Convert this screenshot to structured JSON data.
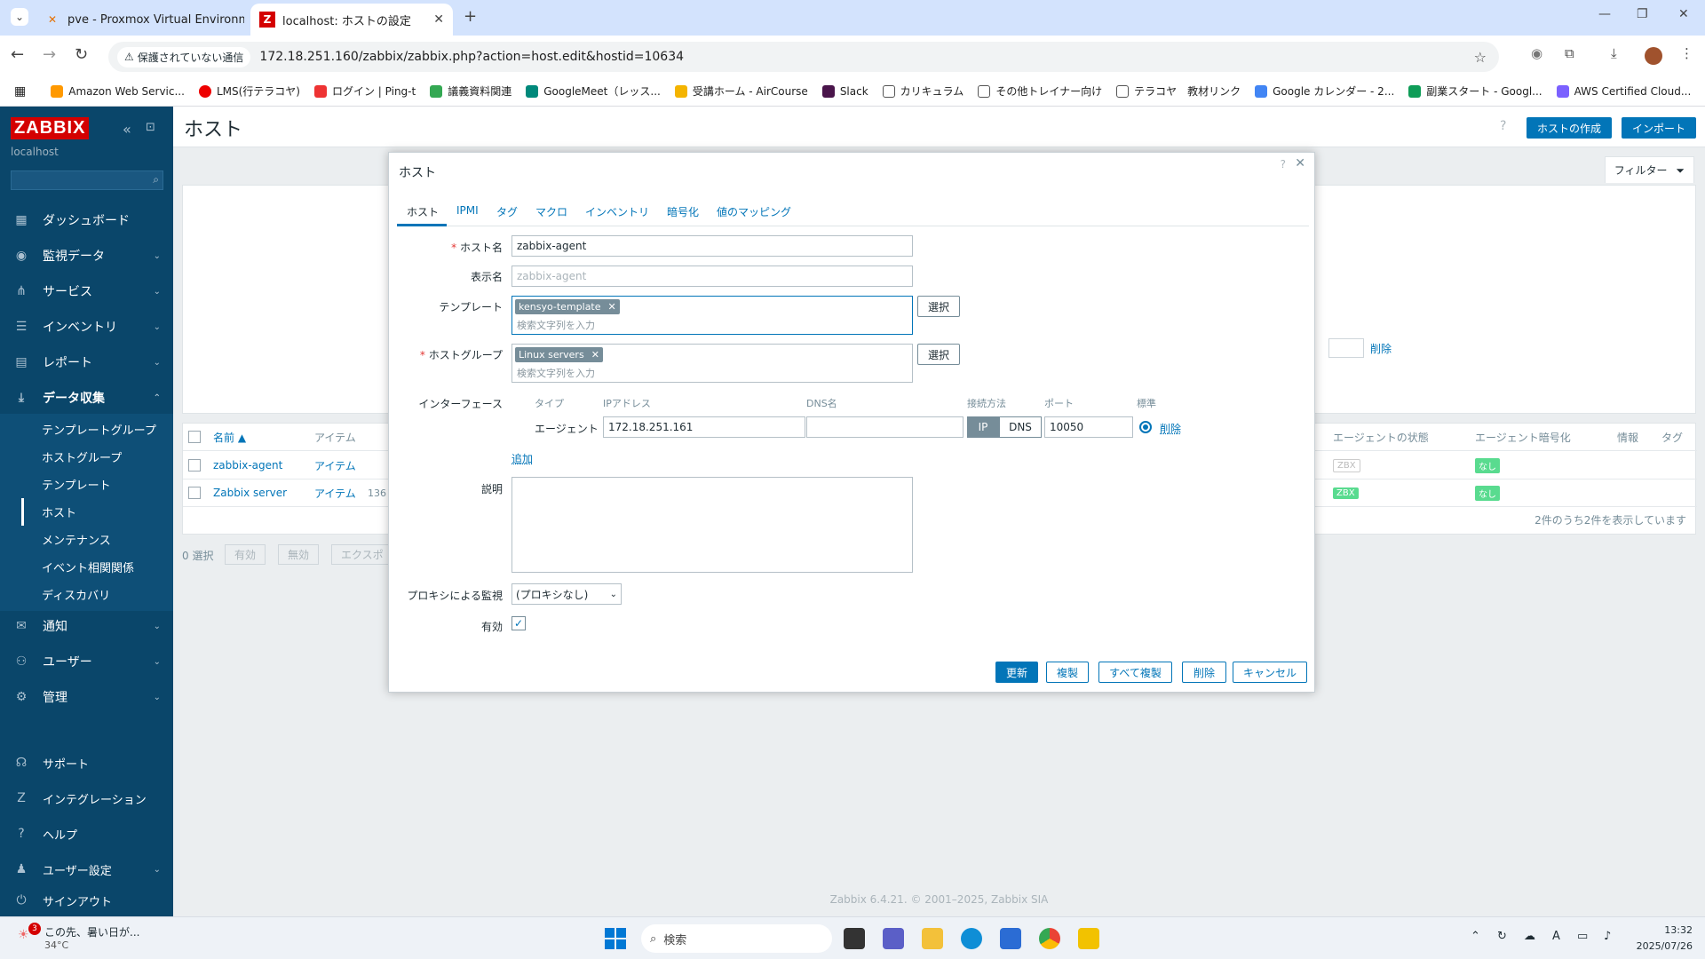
{
  "browser": {
    "tabs": [
      {
        "title": "pve - Proxmox Virtual Environm"
      },
      {
        "title": "localhost: ホストの設定"
      }
    ],
    "security_label": "保護されていない通信",
    "url": "172.18.251.160/zabbix/zabbix.php?action=host.edit&hostid=10634",
    "bookmarks": [
      "Amazon Web Servic...",
      "LMS(行テラコヤ)",
      "ログイン | Ping-t",
      "議義資料関連",
      "GoogleMeet（レッス...",
      "受講ホーム - AirCourse",
      "Slack",
      "カリキュラム",
      "その他トレイナー向け",
      "テラコヤ　教材リンク",
      "Google カレンダー - 2...",
      "副業スタート - Googl...",
      "AWS Certified Cloud..."
    ]
  },
  "sidebar": {
    "logo": "ZABBIX",
    "server": "localhost",
    "items": [
      {
        "label": "ダッシュボード",
        "icon": "dashboard-icon"
      },
      {
        "label": "監視データ",
        "icon": "eye-icon"
      },
      {
        "label": "サービス",
        "icon": "services-icon"
      },
      {
        "label": "インベントリ",
        "icon": "list-icon"
      },
      {
        "label": "レポート",
        "icon": "report-icon"
      },
      {
        "label": "データ収集",
        "icon": "download-icon"
      }
    ],
    "sub_items": [
      "テンプレートグループ",
      "ホストグループ",
      "テンプレート",
      "ホスト",
      "メンテナンス",
      "イベント相関関係",
      "ディスカバリ"
    ],
    "items2": [
      {
        "label": "通知",
        "icon": "mail-icon"
      },
      {
        "label": "ユーザー",
        "icon": "users-icon"
      },
      {
        "label": "管理",
        "icon": "gear-icon"
      }
    ],
    "bottom": [
      {
        "label": "サポート",
        "icon": "headset-icon"
      },
      {
        "label": "インテグレーション",
        "icon": "integration-icon"
      },
      {
        "label": "ヘルプ",
        "icon": "help-icon"
      },
      {
        "label": "ユーザー設定",
        "icon": "user-icon"
      },
      {
        "label": "サインアウト",
        "icon": "power-icon"
      }
    ]
  },
  "page": {
    "title": "ホスト",
    "create_host": "ホストの作成",
    "import": "インポート",
    "filter": "フィルター",
    "filter_delete": "削除",
    "footer": "Zabbix 6.4.21. © 2001–2025, Zabbix SIA"
  },
  "list": {
    "headers": {
      "name": "名前 ▲",
      "items": "アイテム",
      "agent_status": "エージェントの状態",
      "agent_encryption": "エージェント暗号化",
      "info": "情報",
      "tags": "タグ"
    },
    "rows": [
      {
        "name": "zabbix-agent",
        "items": "アイテム",
        "items_count": "",
        "zbx": "ZBX",
        "enc": "なし"
      },
      {
        "name": "Zabbix server",
        "items": "アイテム",
        "items_count": "136",
        "zbx": "ZBX",
        "enc": "なし"
      }
    ],
    "summary": "2件のうち2件を表示しています",
    "selected": "0 選択",
    "actions": [
      "有効",
      "無効",
      "エクスポ"
    ]
  },
  "modal": {
    "title": "ホスト",
    "tabs": [
      "ホスト",
      "IPMI",
      "タグ",
      "マクロ",
      "インベントリ",
      "暗号化",
      "値のマッピング"
    ],
    "host_name_label": "ホスト名",
    "host_name": "zabbix-agent",
    "visible_name_label": "表示名",
    "visible_name_placeholder": "zabbix-agent",
    "templates_label": "テンプレート",
    "template_chip": "kensyo-template",
    "search_placeholder": "検索文字列を入力",
    "select": "選択",
    "host_groups_label": "ホストグループ",
    "group_chip": "Linux servers",
    "interfaces_label": "インターフェース",
    "iface_headers": {
      "type": "タイプ",
      "ip": "IPアドレス",
      "dns": "DNS名",
      "connect": "接続方法",
      "port": "ポート",
      "default": "標準"
    },
    "iface": {
      "type": "エージェント",
      "ip": "172.18.251.161",
      "dns": "",
      "ip_btn": "IP",
      "dns_btn": "DNS",
      "port": "10050",
      "remove": "削除"
    },
    "add": "追加",
    "description_label": "説明",
    "proxy_label": "プロキシによる監視",
    "proxy_value": "(プロキシなし)",
    "enabled_label": "有効",
    "buttons": {
      "update": "更新",
      "clone": "複製",
      "full_clone": "すべて複製",
      "delete": "削除",
      "cancel": "キャンセル"
    }
  },
  "taskbar": {
    "weather_text": "この先、暑い日が...",
    "temp": "34°C",
    "badge": "3",
    "search": "検索",
    "time": "13:32",
    "date": "2025/07/26"
  },
  "colors": {
    "sidebar": "#0a466a",
    "accent": "#0275b8",
    "zabbix_red": "#d40000",
    "ok_green": "#59db8f"
  }
}
